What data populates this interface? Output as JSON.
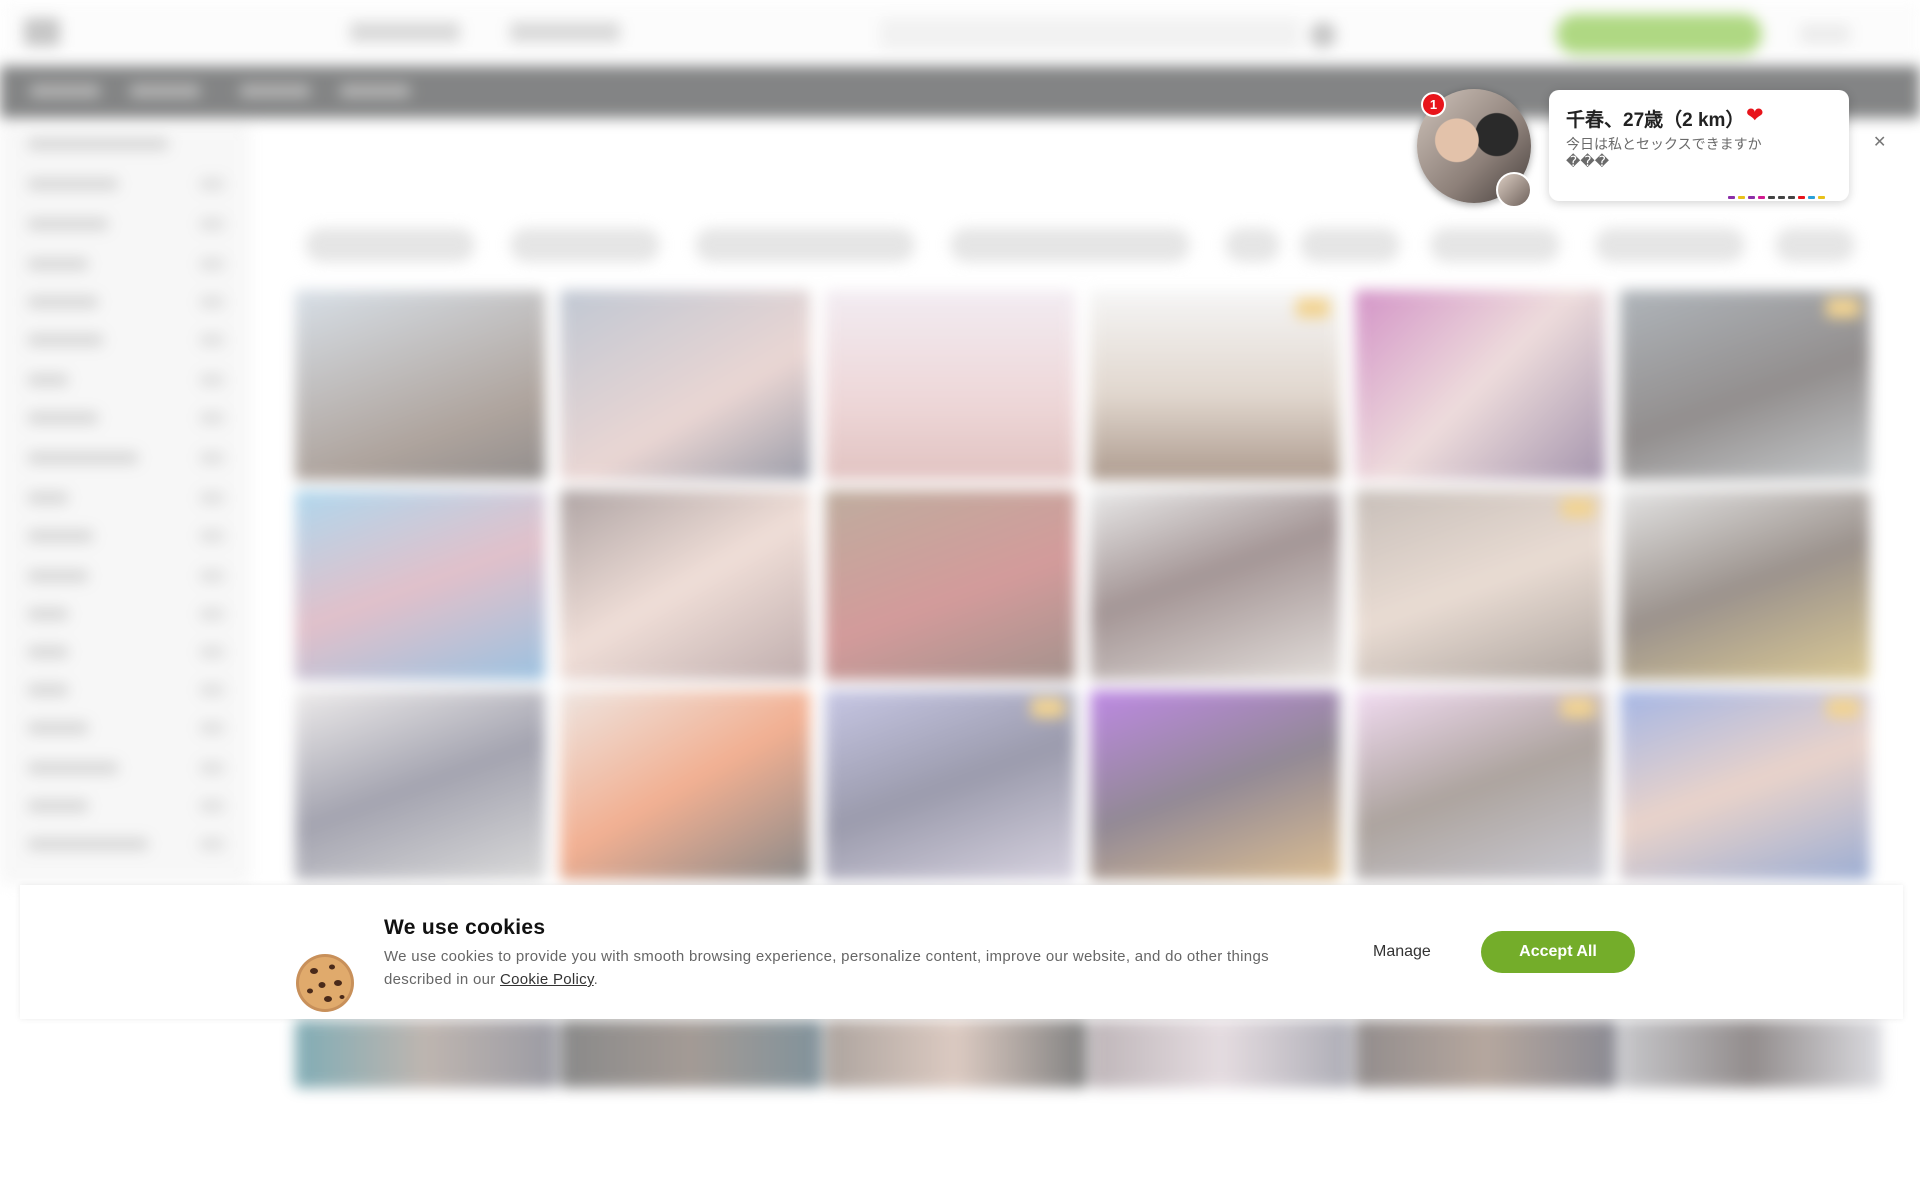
{
  "notification": {
    "unread_count": "1",
    "name_line": "千春、27歳（2 km）",
    "heart_icon": "heart-icon",
    "message": "今日は私とセックスできますか\n���",
    "progress_colors": [
      "#8b2fa8",
      "#e8c11a",
      "#8b2fa8",
      "#d11a8f",
      "#444444",
      "#444444",
      "#444444",
      "#e8141b",
      "#2aa0d8",
      "#e8c11a"
    ],
    "close_icon": "close-icon"
  },
  "cookie": {
    "icon": "cookie-icon",
    "title": "We use cookies",
    "text_before_link": "We use cookies to provide you with smooth browsing experience, personalize content, improve our website, and do other things described in our ",
    "link_label": "Cookie Policy",
    "text_after_link": ".",
    "manage_label": "Manage",
    "accept_label": "Accept All",
    "accept_color": "#74ad2a"
  },
  "colors": {
    "signup_button": "#6fba1e",
    "navbar": "#1f2122"
  }
}
